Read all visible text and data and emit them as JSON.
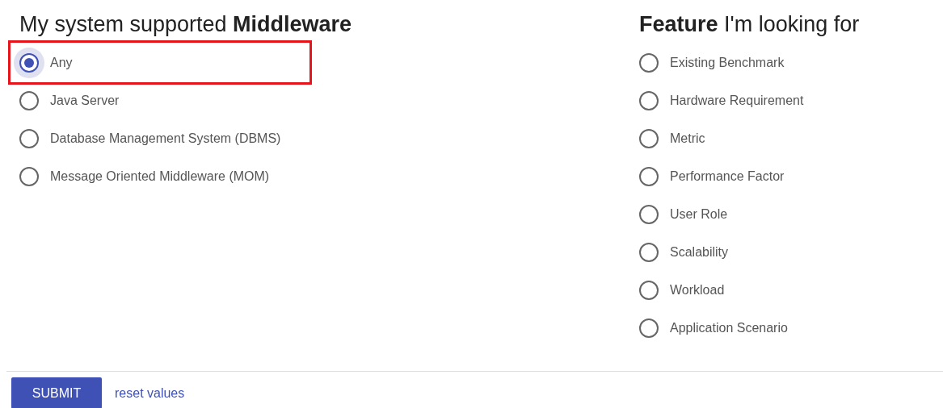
{
  "groups": [
    {
      "heading": "My system supported **Middleware**",
      "options": [
        {
          "label": "Any",
          "selected": true,
          "highlighted": true
        },
        {
          "label": "Java Server",
          "selected": false,
          "highlighted": false
        },
        {
          "label": "Database Management System (DBMS)",
          "selected": false,
          "highlighted": false
        },
        {
          "label": "Message Oriented Middleware (MOM)",
          "selected": false,
          "highlighted": false
        }
      ]
    },
    {
      "heading": "**Feature** I'm looking for",
      "options": [
        {
          "label": "Existing Benchmark",
          "selected": false,
          "highlighted": false
        },
        {
          "label": "Hardware Requirement",
          "selected": false,
          "highlighted": false
        },
        {
          "label": "Metric",
          "selected": false,
          "highlighted": false
        },
        {
          "label": "Performance Factor",
          "selected": false,
          "highlighted": false
        },
        {
          "label": "User Role",
          "selected": false,
          "highlighted": false
        },
        {
          "label": "Scalability",
          "selected": false,
          "highlighted": false
        },
        {
          "label": "Workload",
          "selected": false,
          "highlighted": false
        },
        {
          "label": "Application Scenario",
          "selected": false,
          "highlighted": false
        }
      ]
    }
  ],
  "submit": "SUBMIT",
  "reset": "reset values"
}
